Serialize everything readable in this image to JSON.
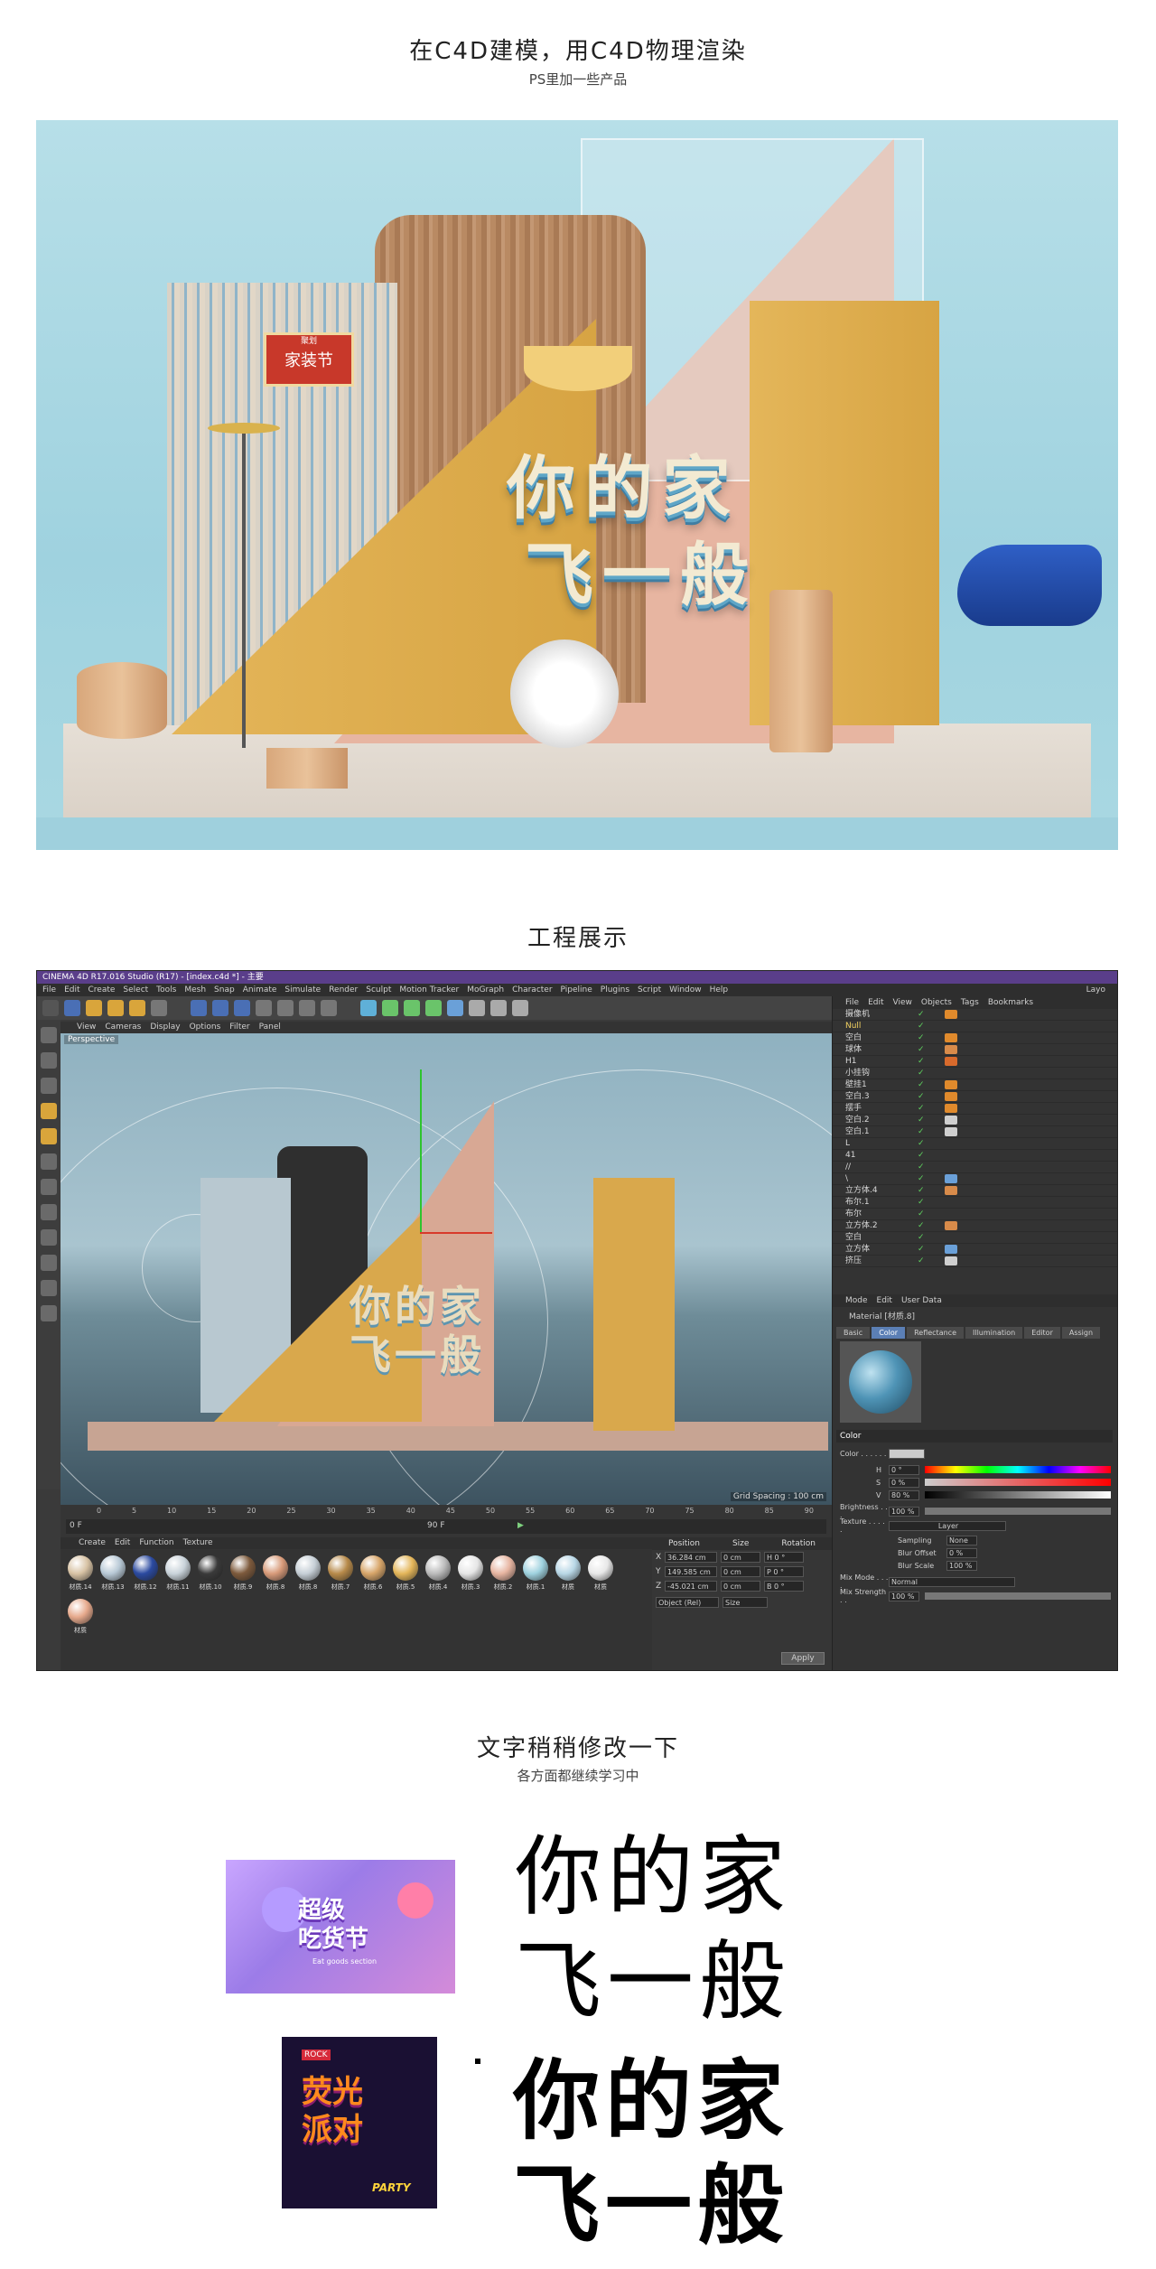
{
  "sections": {
    "s1_title": "在C4D建模，用C4D物理渲染",
    "s1_sub": "PS里加一些产品",
    "s2_title": "工程展示",
    "s3_title": "文字稍稍修改一下",
    "s3_sub": "各方面都继续学习中"
  },
  "render": {
    "headline_line1": "你的家",
    "headline_line2": "飞一般",
    "badge_title": "家装节",
    "badge_top": "聚划"
  },
  "c4d": {
    "window_title": "CINEMA 4D R17.016 Studio (R17) - [index.c4d *] - 主要",
    "menu": [
      "File",
      "Edit",
      "Create",
      "Select",
      "Tools",
      "Mesh",
      "Snap",
      "Animate",
      "Simulate",
      "Render",
      "Sculpt",
      "Motion Tracker",
      "MoGraph",
      "Character",
      "Pipeline",
      "Plugins",
      "Script",
      "Window",
      "Help"
    ],
    "layout_label": "Layo",
    "view_menu": [
      "View",
      "Cameras",
      "Display",
      "Options",
      "Filter",
      "Panel"
    ],
    "viewport_label": "Perspective",
    "grid_spacing": "Grid Spacing : 100 cm",
    "timeline_ticks": [
      "0",
      "5",
      "10",
      "15",
      "20",
      "25",
      "30",
      "35",
      "40",
      "45",
      "50",
      "55",
      "60",
      "65",
      "70",
      "75",
      "80",
      "85",
      "90"
    ],
    "timeline_start": "0 F",
    "timeline_end": "90 F",
    "timeline_current": "0 F",
    "material_menu": [
      "Create",
      "Edit",
      "Function",
      "Texture"
    ],
    "materials": [
      {
        "name": "材质.14",
        "color": "#d8c3a5"
      },
      {
        "name": "材质.13",
        "color": "#b8c9d6"
      },
      {
        "name": "材质.12",
        "color": "#2b4aa0"
      },
      {
        "name": "材质.11",
        "color": "#c9d3da"
      },
      {
        "name": "材质.10",
        "color": "#3a3a3a"
      },
      {
        "name": "材质.9",
        "color": "#7d5a3c"
      },
      {
        "name": "材质.8",
        "color": "#d89b7a"
      },
      {
        "name": "材质.8",
        "color": "#c6cfd6"
      },
      {
        "name": "材质.7",
        "color": "#b78a4a"
      },
      {
        "name": "材质.6",
        "color": "#d8a66a"
      },
      {
        "name": "材质.5",
        "color": "#e4b65a"
      },
      {
        "name": "材质.4",
        "color": "#bbbbbb"
      },
      {
        "name": "材质.3",
        "color": "#e6e6e6"
      },
      {
        "name": "材质.2",
        "color": "#e7b5a1"
      },
      {
        "name": "材质.1",
        "color": "#9fd2df"
      },
      {
        "name": "材质",
        "color": "#b8d7e6"
      },
      {
        "name": "材质",
        "color": "#e8e8e8"
      },
      {
        "name": "材质",
        "color": "#e6a98c"
      }
    ],
    "coords_head": [
      "Position",
      "Size",
      "Rotation"
    ],
    "coords": [
      {
        "axis": "X",
        "pos": "36.284 cm",
        "size": "0 cm",
        "rot": "H  0 °"
      },
      {
        "axis": "Y",
        "pos": "149.585 cm",
        "size": "0 cm",
        "rot": "P  0 °"
      },
      {
        "axis": "Z",
        "pos": "-45.021 cm",
        "size": "0 cm",
        "rot": "B  0 °"
      }
    ],
    "coord_mode": "Object (Rel)",
    "coord_size_mode": "Size",
    "apply": "Apply",
    "objmgr_menu": [
      "File",
      "Edit",
      "View",
      "Objects",
      "Tags",
      "Bookmarks"
    ],
    "objects": [
      {
        "name": "摄像机",
        "ck": "✓",
        "tag": "#e08a2c"
      },
      {
        "name": "Null",
        "ck": "✓",
        "tag": ""
      },
      {
        "name": "空白",
        "ck": "✓",
        "tag": "#e08a2c"
      },
      {
        "name": "球体",
        "ck": "✓",
        "tag": "#d88b4a"
      },
      {
        "name": "H1",
        "ck": "✓",
        "tag": "#d86a2c"
      },
      {
        "name": "小挂钩",
        "ck": "✓",
        "tag": ""
      },
      {
        "name": "壁挂1",
        "ck": "✓",
        "tag": "#e08a2c"
      },
      {
        "name": "空白.3",
        "ck": "✓",
        "tag": "#e08a2c"
      },
      {
        "name": "摆手",
        "ck": "✓",
        "tag": "#e08a2c"
      },
      {
        "name": "空白.2",
        "ck": "✓",
        "tag": "#cfcfcf"
      },
      {
        "name": "空白.1",
        "ck": "✓",
        "tag": "#cfcfcf"
      },
      {
        "name": "L",
        "ck": "✓",
        "tag": ""
      },
      {
        "name": "41",
        "ck": "✓",
        "tag": ""
      },
      {
        "name": "//",
        "ck": "✓",
        "tag": ""
      },
      {
        "name": "\\",
        "ck": "✓",
        "tag": "#6aa0d8"
      },
      {
        "name": "立方体.4",
        "ck": "✓",
        "tag": "#d88b4a"
      },
      {
        "name": "布尔.1",
        "ck": "✓",
        "tag": ""
      },
      {
        "name": "布尔",
        "ck": "✓",
        "tag": ""
      },
      {
        "name": "立方体.2",
        "ck": "✓",
        "tag": "#d88b4a"
      },
      {
        "name": "空白",
        "ck": "✓",
        "tag": ""
      },
      {
        "name": "立方体",
        "ck": "✓",
        "tag": "#6aa0d8"
      },
      {
        "name": "挤压",
        "ck": "✓",
        "tag": "#cfcfcf"
      }
    ],
    "attr_menu": [
      "Mode",
      "Edit",
      "User Data"
    ],
    "attr_material": "Material [材质.8]",
    "attr_tabs": [
      "Basic",
      "Color",
      "Reflectance",
      "Illumination",
      "Editor",
      "Assign"
    ],
    "attr_section": "Color",
    "attr_color_label": "Color . . . . . .",
    "attr_h": "H",
    "attr_h_val": "0 °",
    "attr_s": "S",
    "attr_s_val": "0 %",
    "attr_v": "V",
    "attr_v_val": "80 %",
    "attr_brightness": "Brightness . . .",
    "attr_brightness_val": "100 %",
    "attr_texture": "Texture . . . . .",
    "attr_layer": "Layer",
    "attr_sampling": "Sampling",
    "attr_sampling_val": "None",
    "attr_blur_offset": "Blur Offset",
    "attr_blur_offset_val": "0 %",
    "attr_blur_scale": "Blur Scale",
    "attr_blur_scale_val": "100 %",
    "attr_mix_mode": "Mix Mode . . . .",
    "attr_mix_mode_val": "Normal",
    "attr_mix_strength": "Mix Strength . .",
    "attr_mix_strength_val": "100 %"
  },
  "examples": {
    "thumb1_line1": "超级",
    "thumb1_line2": "吃货节",
    "thumb1_sub": "Eat goods section",
    "thumb2_tag": "ROCK",
    "thumb2_line1": "荧光",
    "thumb2_line2": "派对",
    "thumb2_party": "PARTY",
    "text_a_line1": "你的家",
    "text_a_line2": "飞一般",
    "text_b_line1": "你的家",
    "text_b_line2": "飞一般"
  }
}
